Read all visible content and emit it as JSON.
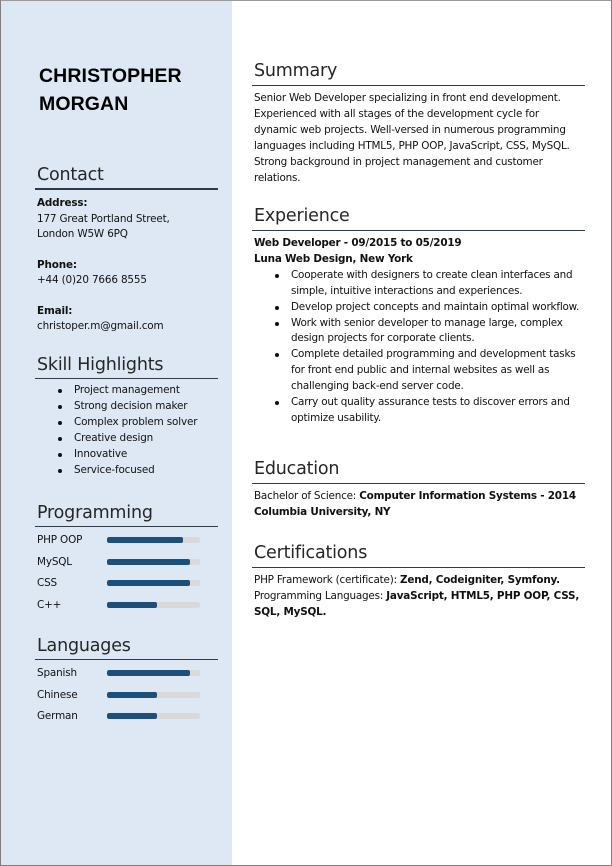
{
  "person": {
    "name_line1": "CHRISTOPHER",
    "name_line2": "MORGAN"
  },
  "contact": {
    "title": "Contact",
    "address_label": "Address:",
    "address_line1": "177 Great Portland Street,",
    "address_line2": "London W5W 6PQ",
    "phone_label": "Phone:",
    "phone": "+44 (0)20 7666 8555",
    "email_label": "Email:",
    "email": "christoper.m@gmail.com"
  },
  "skills": {
    "title": "Skill Highlights",
    "items": [
      "Project management",
      "Strong decision maker",
      "Complex problem solver",
      "Creative design",
      "Innovative",
      "Service-focused"
    ]
  },
  "programming": {
    "title": "Programming",
    "items": [
      {
        "label": "PHP OOP",
        "level_percent": 82
      },
      {
        "label": "MySQL",
        "level_percent": 89
      },
      {
        "label": "CSS",
        "level_percent": 89
      },
      {
        "label": "C++",
        "level_percent": 54
      }
    ]
  },
  "languages": {
    "title": "Languages",
    "items": [
      {
        "label": "Spanish",
        "level_percent": 89
      },
      {
        "label": "Chinese",
        "level_percent": 54
      },
      {
        "label": "German",
        "level_percent": 54
      }
    ]
  },
  "summary": {
    "title": "Summary",
    "text": "Senior Web Developer specializing in front end development. Experienced with all stages of the development cycle for dynamic web projects. Well-versed in numerous programming languages including HTML5, PHP OOP, JavaScript, CSS, MySQL. Strong background in project management and customer relations."
  },
  "experience": {
    "title": "Experience",
    "job_title_line": "Web Developer - 09/2015 to 05/2019",
    "company_line": "Luna Web Design, New York",
    "bullets": [
      "Cooperate with designers to create clean interfaces and simple, intuitive interactions and experiences.",
      "Develop project concepts and maintain optimal workflow.",
      "Work with senior developer to manage large, complex design projects for corporate clients.",
      "Complete detailed programming and development tasks for front end public and internal websites as well as challenging back-end server code.",
      "Carry out quality assurance tests to discover errors and optimize usability."
    ]
  },
  "education": {
    "title": "Education",
    "degree_prefix": "Bachelor of Science: ",
    "degree_field": "Computer Information Systems - 2014",
    "school": "Columbia University, NY"
  },
  "certifications": {
    "title": "Certifications",
    "line1_prefix": "PHP Framework (certificate): ",
    "line1_value": "Zend, Codeigniter, Symfony.",
    "line2_prefix": "Programming Languages: ",
    "line2_value": "JavaScript, HTML5, PHP OOP, CSS, SQL, MySQL."
  }
}
